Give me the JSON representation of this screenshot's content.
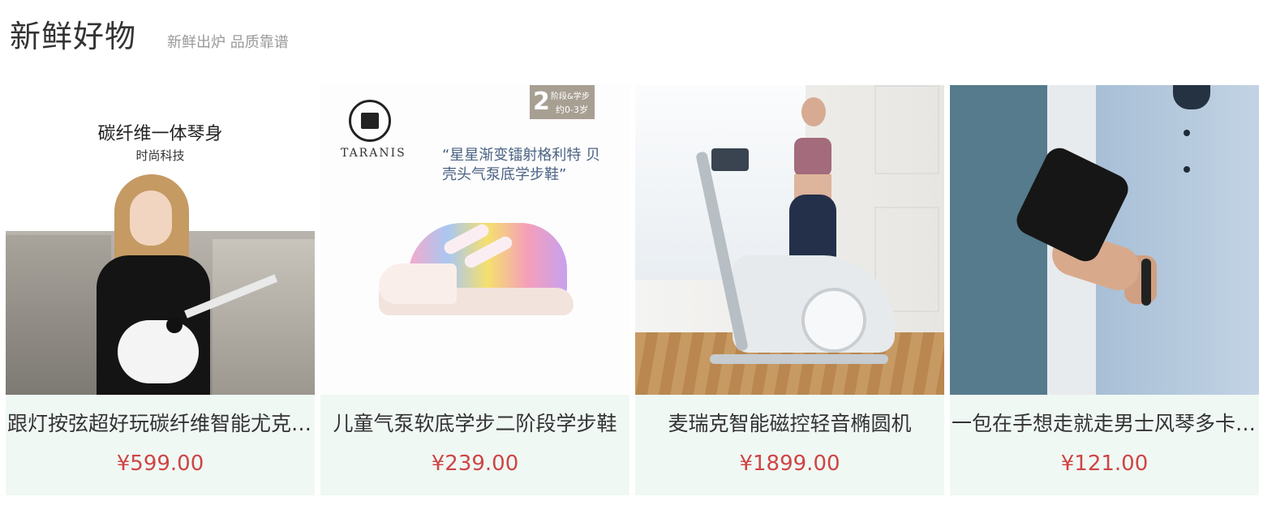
{
  "header": {
    "title": "新鲜好物",
    "subtitle": "新鲜出炉 品质靠谱"
  },
  "products": [
    {
      "name": "跟灯按弦超好玩碳纤维智能尤克里里",
      "price": "¥599.00",
      "image_text": {
        "headline": "碳纤维一体琴身",
        "sub": "时尚科技"
      }
    },
    {
      "name": "儿童气泵软底学步二阶段学步鞋",
      "price": "¥239.00",
      "image_text": {
        "brand": "TARANIS",
        "badge_num": "2",
        "badge_t1": "阶段&学步",
        "badge_t2": "约0-3岁",
        "quote": "“星星渐变镭射格利特 贝壳头气泵底学步鞋”"
      }
    },
    {
      "name": "麦瑞克智能磁控轻音椭圆机",
      "price": "¥1899.00"
    },
    {
      "name": "一包在手想走就走男士风琴多卡位钱包",
      "price": "¥121.00"
    }
  ],
  "colors": {
    "price": "#cf4444",
    "card_bg": "#f0f8f4",
    "subtitle": "#999999"
  }
}
